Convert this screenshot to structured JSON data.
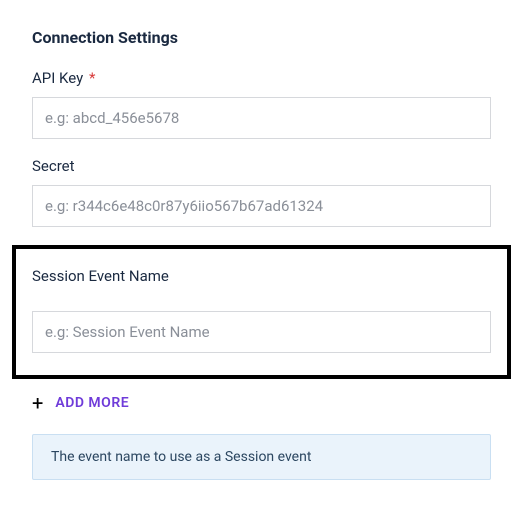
{
  "section": {
    "title": "Connection Settings"
  },
  "fields": {
    "api_key": {
      "label": "API Key",
      "required_marker": "*",
      "placeholder": "e.g: abcd_456e5678",
      "value": ""
    },
    "secret": {
      "label": "Secret",
      "placeholder": "e.g: r344c6e48c0r87y6iio567b67ad61324",
      "value": ""
    },
    "session_event_name": {
      "label": "Session Event Name",
      "placeholder": "e.g: Session Event Name",
      "value": ""
    }
  },
  "add_more": {
    "icon": "plus-icon",
    "label": "ADD MORE"
  },
  "hint": {
    "text": "The event name to use as a Session event"
  }
}
